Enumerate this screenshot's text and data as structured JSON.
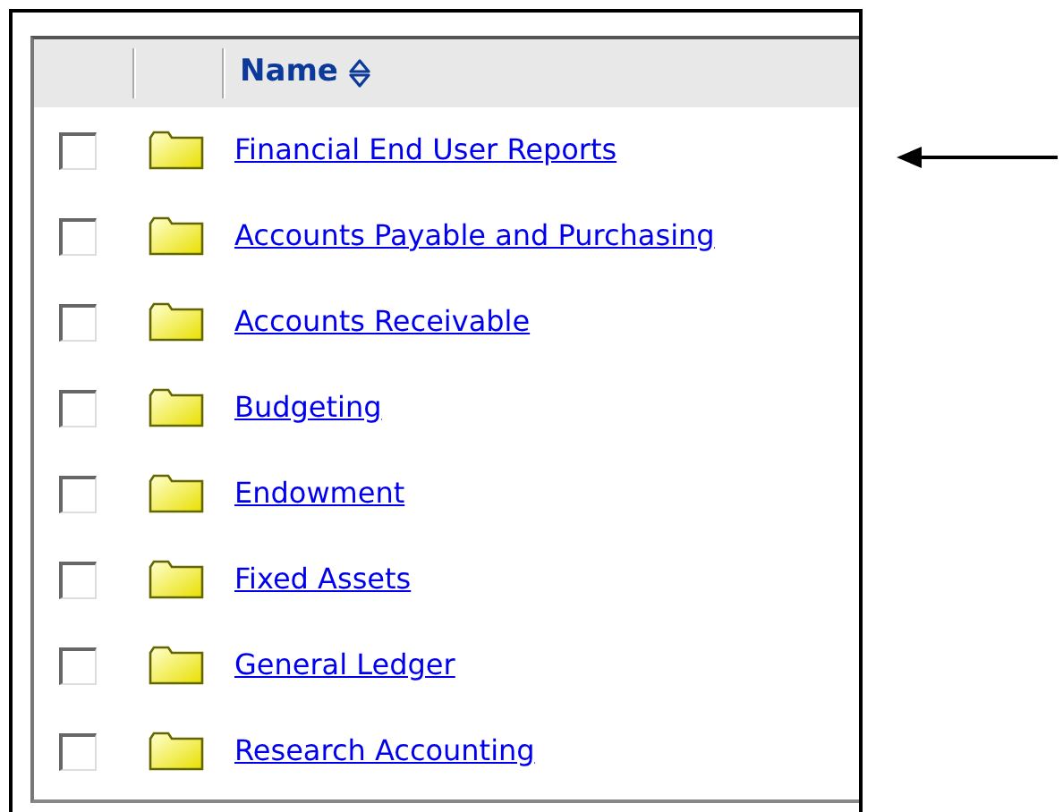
{
  "table": {
    "header": {
      "label": "Name",
      "sortable": true
    },
    "rows": [
      {
        "label": "Financial End User Reports",
        "checked": false
      },
      {
        "label": "Accounts Payable and Purchasing",
        "checked": false
      },
      {
        "label": "Accounts Receivable",
        "checked": false
      },
      {
        "label": "Budgeting",
        "checked": false
      },
      {
        "label": "Endowment",
        "checked": false
      },
      {
        "label": "Fixed Assets",
        "checked": false
      },
      {
        "label": "General Ledger",
        "checked": false
      },
      {
        "label": "Research Accounting",
        "checked": false
      }
    ]
  }
}
